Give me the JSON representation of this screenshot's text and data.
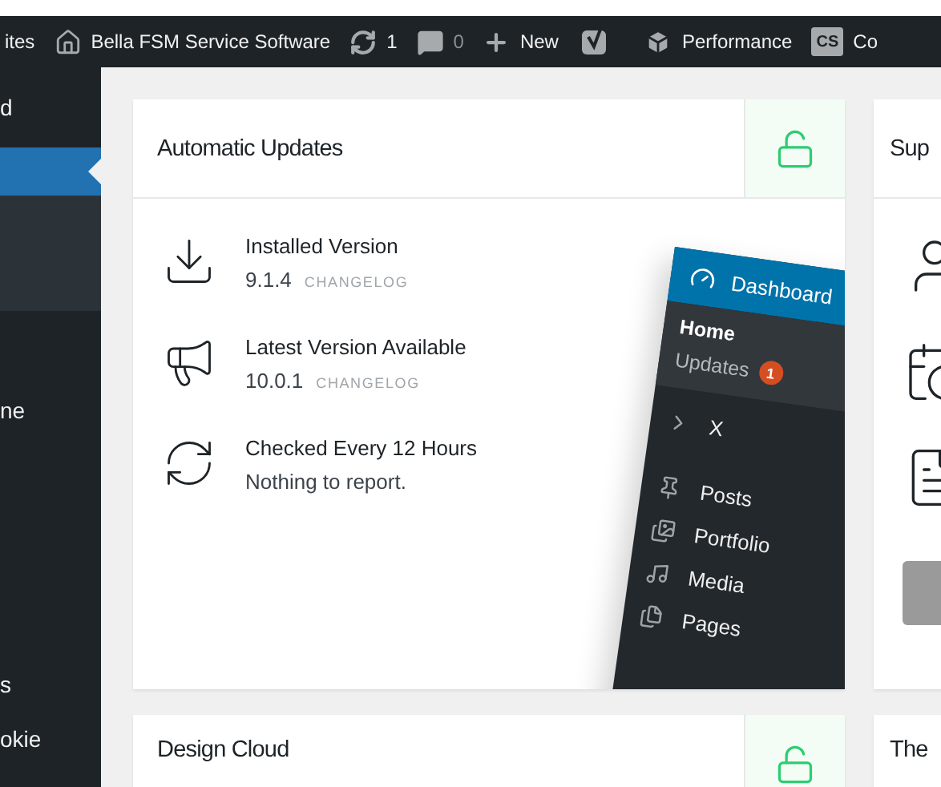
{
  "admin_bar": {
    "items": [
      {
        "kind": "text",
        "label": "ites"
      },
      {
        "kind": "home",
        "label": "Bella FSM Service Software"
      },
      {
        "kind": "updates",
        "label": "1"
      },
      {
        "kind": "comments",
        "label": "0"
      },
      {
        "kind": "new",
        "label": "New"
      },
      {
        "kind": "yoast"
      },
      {
        "kind": "performance",
        "label": "Performance"
      },
      {
        "kind": "cs",
        "badge": "CS",
        "label": "Co"
      }
    ]
  },
  "sidebar": {
    "items": [
      {
        "label": "d",
        "selected": false
      },
      {
        "selected": true
      }
    ],
    "lower_items": [
      {
        "label": "ne"
      }
    ],
    "bottom_items": [
      {
        "label": "s"
      },
      {
        "label": "okie"
      }
    ]
  },
  "cards": [
    {
      "kind": "updates",
      "title": "Automatic Updates",
      "rows": [
        {
          "kind": "download",
          "title": "Installed Version",
          "version": "9.1.4",
          "link": "CHANGELOG"
        },
        {
          "kind": "megaphone",
          "title": "Latest Version Available",
          "version": "10.0.1",
          "link": "CHANGELOG"
        },
        {
          "kind": "refresh",
          "title": "Checked Every 12 Hours",
          "text": "Nothing to report."
        }
      ],
      "screenshot": {
        "header": "Dashboard",
        "submenu": [
          {
            "label": "Home",
            "selected": true
          },
          {
            "label": "Updates",
            "selected": false,
            "badge": "1"
          }
        ],
        "items": [
          {
            "kind": "chevron",
            "label": "X"
          },
          {
            "kind": "pin",
            "label": "Posts"
          },
          {
            "kind": "gallery",
            "label": "Portfolio"
          },
          {
            "kind": "media",
            "label": "Media"
          },
          {
            "kind": "pages",
            "label": "Pages"
          }
        ]
      }
    },
    {
      "kind": "support",
      "title": "Sup",
      "icons": [
        {
          "kind": "person"
        },
        {
          "kind": "clock-sign"
        },
        {
          "kind": "document"
        }
      ]
    },
    {
      "kind": "lock",
      "title": "Design Cloud"
    },
    {
      "kind": "plain",
      "title": "The"
    }
  ]
}
